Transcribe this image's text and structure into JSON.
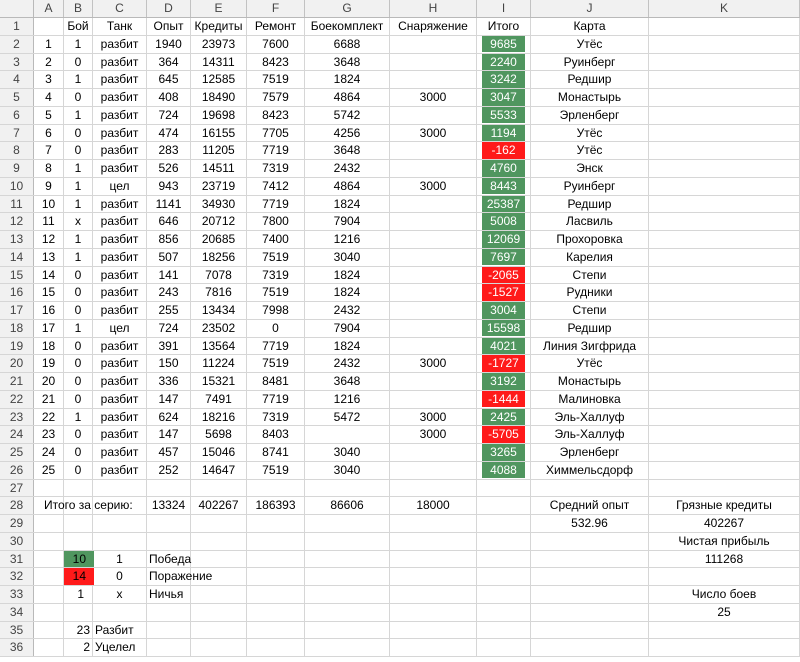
{
  "columns": [
    "A",
    "B",
    "C",
    "D",
    "E",
    "F",
    "G",
    "H",
    "I",
    "J",
    "K"
  ],
  "header": {
    "b": "Бой",
    "c": "Танк",
    "d": "Опыт",
    "e": "Кредиты",
    "f": "Ремонт",
    "g": "Боекомплект",
    "h": "Снаряжение",
    "i": "Итого",
    "j": "Карта"
  },
  "battles": [
    {
      "a": "1",
      "b": "1",
      "c": "разбит",
      "d": "1940",
      "e": "23973",
      "f": "7600",
      "g": "6688",
      "h": "",
      "i": "9685",
      "pos": true,
      "j": "Утёс"
    },
    {
      "a": "2",
      "b": "0",
      "c": "разбит",
      "d": "364",
      "e": "14311",
      "f": "8423",
      "g": "3648",
      "h": "",
      "i": "2240",
      "pos": true,
      "j": "Руинберг"
    },
    {
      "a": "3",
      "b": "1",
      "c": "разбит",
      "d": "645",
      "e": "12585",
      "f": "7519",
      "g": "1824",
      "h": "",
      "i": "3242",
      "pos": true,
      "j": "Редшир"
    },
    {
      "a": "4",
      "b": "0",
      "c": "разбит",
      "d": "408",
      "e": "18490",
      "f": "7579",
      "g": "4864",
      "h": "3000",
      "i": "3047",
      "pos": true,
      "j": "Монастырь"
    },
    {
      "a": "5",
      "b": "1",
      "c": "разбит",
      "d": "724",
      "e": "19698",
      "f": "8423",
      "g": "5742",
      "h": "",
      "i": "5533",
      "pos": true,
      "j": "Эрленберг"
    },
    {
      "a": "6",
      "b": "0",
      "c": "разбит",
      "d": "474",
      "e": "16155",
      "f": "7705",
      "g": "4256",
      "h": "3000",
      "i": "1194",
      "pos": true,
      "j": "Утёс"
    },
    {
      "a": "7",
      "b": "0",
      "c": "разбит",
      "d": "283",
      "e": "11205",
      "f": "7719",
      "g": "3648",
      "h": "",
      "i": "-162",
      "pos": false,
      "j": "Утёс"
    },
    {
      "a": "8",
      "b": "1",
      "c": "разбит",
      "d": "526",
      "e": "14511",
      "f": "7319",
      "g": "2432",
      "h": "",
      "i": "4760",
      "pos": true,
      "j": "Энск"
    },
    {
      "a": "9",
      "b": "1",
      "c": "цел",
      "d": "943",
      "e": "23719",
      "f": "7412",
      "g": "4864",
      "h": "3000",
      "i": "8443",
      "pos": true,
      "j": "Руинберг"
    },
    {
      "a": "10",
      "b": "1",
      "c": "разбит",
      "d": "1141",
      "e": "34930",
      "f": "7719",
      "g": "1824",
      "h": "",
      "i": "25387",
      "pos": true,
      "j": "Редшир"
    },
    {
      "a": "11",
      "b": "x",
      "c": "разбит",
      "d": "646",
      "e": "20712",
      "f": "7800",
      "g": "7904",
      "h": "",
      "i": "5008",
      "pos": true,
      "j": "Ласвиль"
    },
    {
      "a": "12",
      "b": "1",
      "c": "разбит",
      "d": "856",
      "e": "20685",
      "f": "7400",
      "g": "1216",
      "h": "",
      "i": "12069",
      "pos": true,
      "j": "Прохоровка"
    },
    {
      "a": "13",
      "b": "1",
      "c": "разбит",
      "d": "507",
      "e": "18256",
      "f": "7519",
      "g": "3040",
      "h": "",
      "i": "7697",
      "pos": true,
      "j": "Карелия"
    },
    {
      "a": "14",
      "b": "0",
      "c": "разбит",
      "d": "141",
      "e": "7078",
      "f": "7319",
      "g": "1824",
      "h": "",
      "i": "-2065",
      "pos": false,
      "j": "Степи"
    },
    {
      "a": "15",
      "b": "0",
      "c": "разбит",
      "d": "243",
      "e": "7816",
      "f": "7519",
      "g": "1824",
      "h": "",
      "i": "-1527",
      "pos": false,
      "j": "Рудники"
    },
    {
      "a": "16",
      "b": "0",
      "c": "разбит",
      "d": "255",
      "e": "13434",
      "f": "7998",
      "g": "2432",
      "h": "",
      "i": "3004",
      "pos": true,
      "j": "Степи"
    },
    {
      "a": "17",
      "b": "1",
      "c": "цел",
      "d": "724",
      "e": "23502",
      "f": "0",
      "g": "7904",
      "h": "",
      "i": "15598",
      "pos": true,
      "j": "Редшир"
    },
    {
      "a": "18",
      "b": "0",
      "c": "разбит",
      "d": "391",
      "e": "13564",
      "f": "7719",
      "g": "1824",
      "h": "",
      "i": "4021",
      "pos": true,
      "j": "Линия Зигфрида"
    },
    {
      "a": "19",
      "b": "0",
      "c": "разбит",
      "d": "150",
      "e": "11224",
      "f": "7519",
      "g": "2432",
      "h": "3000",
      "i": "-1727",
      "pos": false,
      "j": "Утёс"
    },
    {
      "a": "20",
      "b": "0",
      "c": "разбит",
      "d": "336",
      "e": "15321",
      "f": "8481",
      "g": "3648",
      "h": "",
      "i": "3192",
      "pos": true,
      "j": "Монастырь"
    },
    {
      "a": "21",
      "b": "0",
      "c": "разбит",
      "d": "147",
      "e": "7491",
      "f": "7719",
      "g": "1216",
      "h": "",
      "i": "-1444",
      "pos": false,
      "j": "Малиновка"
    },
    {
      "a": "22",
      "b": "1",
      "c": "разбит",
      "d": "624",
      "e": "18216",
      "f": "7319",
      "g": "5472",
      "h": "3000",
      "i": "2425",
      "pos": true,
      "j": "Эль-Халлуф"
    },
    {
      "a": "23",
      "b": "0",
      "c": "разбит",
      "d": "147",
      "e": "5698",
      "f": "8403",
      "g": "",
      "h": "3000",
      "i": "-5705",
      "pos": false,
      "j": "Эль-Халлуф"
    },
    {
      "a": "24",
      "b": "0",
      "c": "разбит",
      "d": "457",
      "e": "15046",
      "f": "8741",
      "g": "3040",
      "h": "",
      "i": "3265",
      "pos": true,
      "j": "Эрленберг"
    },
    {
      "a": "25",
      "b": "0",
      "c": "разбит",
      "d": "252",
      "e": "14647",
      "f": "7519",
      "g": "3040",
      "h": "",
      "i": "4088",
      "pos": true,
      "j": "Химмельсдорф"
    }
  ],
  "totals": {
    "label": "Итого за серию:",
    "d": "13324",
    "e": "402267",
    "f": "186393",
    "g": "86606",
    "h": "18000",
    "avg_exp_label": "Средний опыт",
    "avg_exp_value": "532.96",
    "dirty_label": "Грязные кредиты",
    "dirty_value": "402267",
    "net_label": "Чистая прибыль",
    "net_value": "111268",
    "count_label": "Число боев",
    "count_value": "25"
  },
  "summary": {
    "wins_count": "10",
    "wins_code": "1",
    "wins_label": "Победа",
    "losses_count": "14",
    "losses_code": "0",
    "losses_label": "Поражение",
    "draws_count": "1",
    "draws_code": "x",
    "draws_label": "Ничья",
    "destroyed_count": "23",
    "destroyed_label": "Разбит",
    "survived_count": "2",
    "survived_label": "Уцелел"
  },
  "colors": {
    "positive": "#50965f",
    "negative": "#ff1a1a"
  }
}
